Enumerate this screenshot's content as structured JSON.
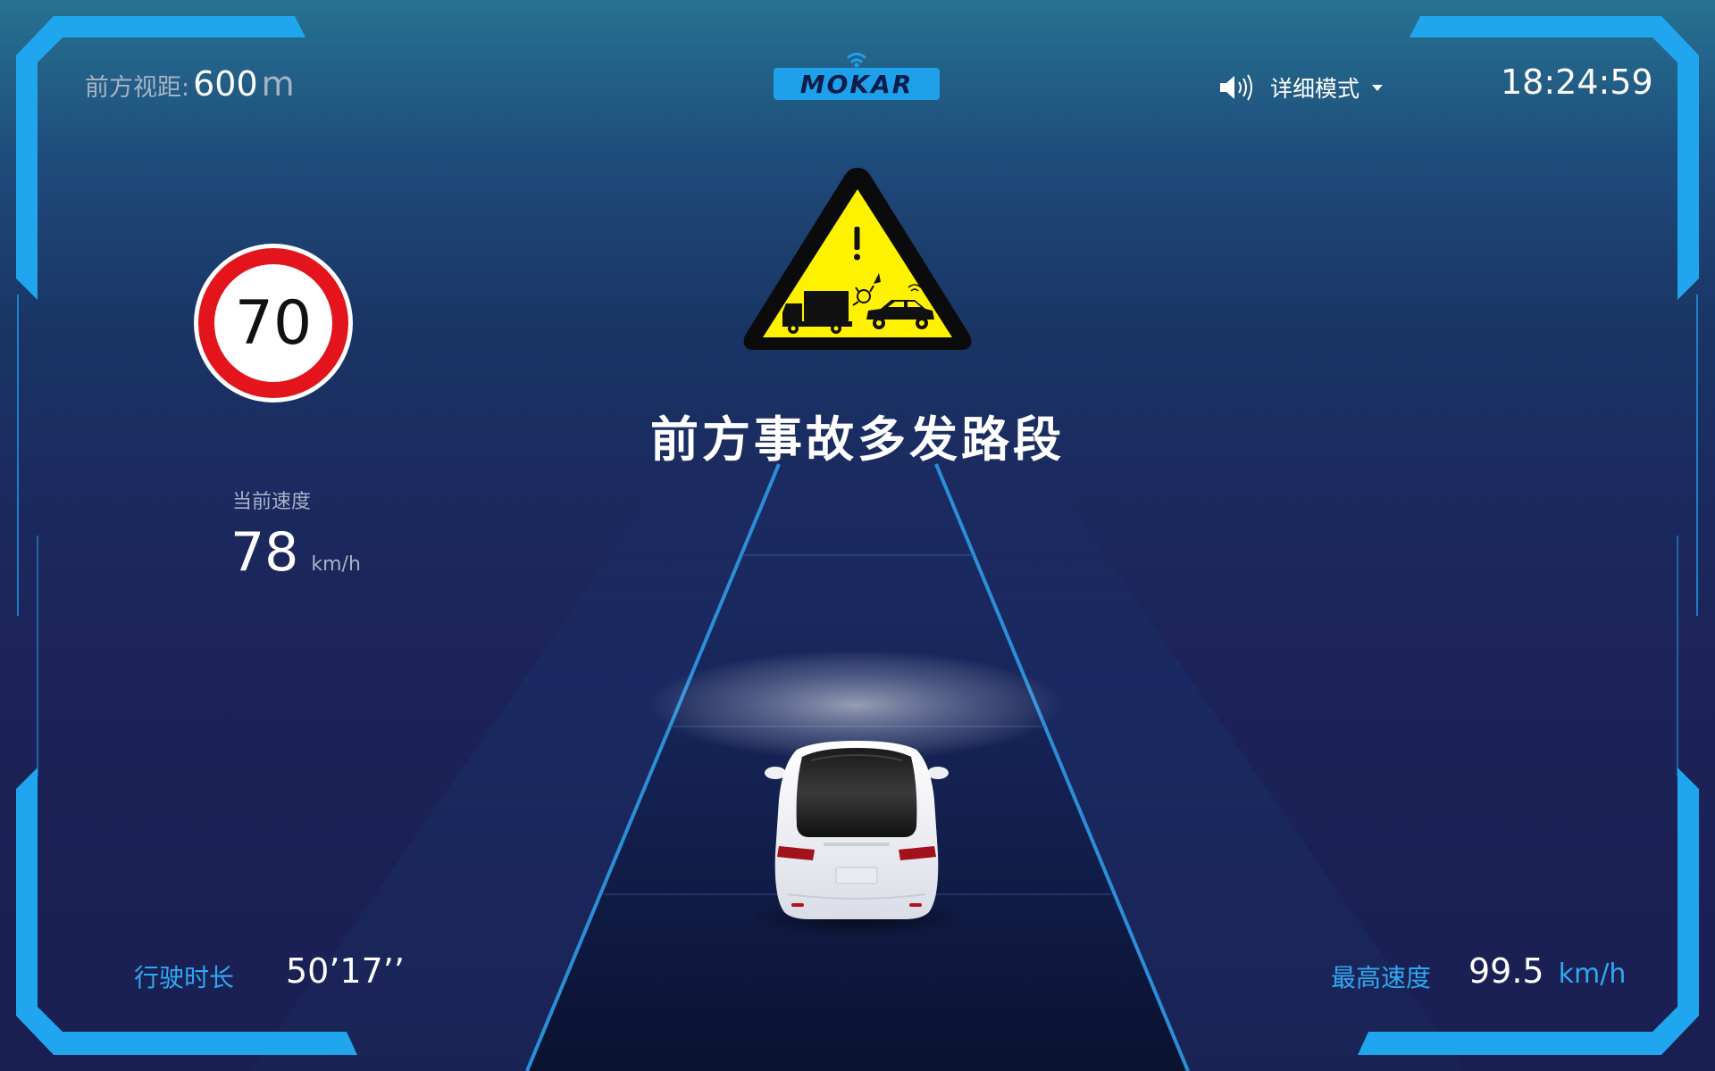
{
  "header": {
    "visibility_label": "前方视距:",
    "visibility_value": "600",
    "visibility_unit": "m",
    "brand": "MOKAR",
    "mode_label": "详细模式",
    "time": "18:24:59"
  },
  "speed_limit": {
    "value": "70"
  },
  "current_speed": {
    "label": "当前速度",
    "value": "78",
    "unit": "km/h"
  },
  "alert": {
    "title": "前方事故多发路段",
    "icon": "accident-warning-icon"
  },
  "footer": {
    "drive_time_label": "行驶时长",
    "drive_time_value": "50’17’’",
    "max_speed_label": "最高速度",
    "max_speed_value": "99.5",
    "max_speed_unit": "km/h"
  },
  "colors": {
    "accent": "#1ea0ea",
    "frame": "#1fa6ee",
    "lane": "#2b8fd8",
    "warning_yellow": "#fff200",
    "limit_red": "#e3141b"
  }
}
